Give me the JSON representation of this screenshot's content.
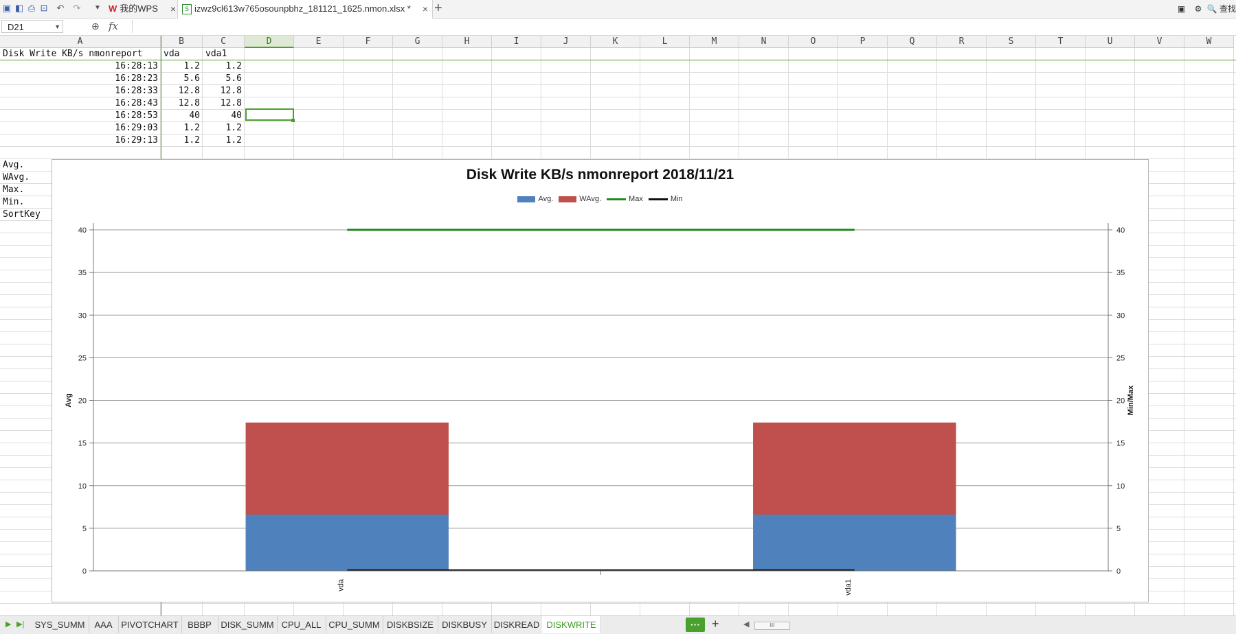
{
  "title_bar": {
    "wps_tab_label": "我的WPS",
    "file_tab_label": "izwz9cl613w765osounpbhz_181121_1625.nmon.xlsx *",
    "close_glyph": "×",
    "new_tab_glyph": "+",
    "search_label": "查找",
    "xls_glyph": "S"
  },
  "formula_bar": {
    "name_box": "D21",
    "fx_label": "fx",
    "formula": ""
  },
  "columns": [
    "A",
    "B",
    "C",
    "D",
    "E",
    "F",
    "G",
    "H",
    "I",
    "J",
    "K",
    "L",
    "M",
    "N",
    "O",
    "P",
    "Q",
    "R",
    "S",
    "T",
    "U",
    "V",
    "W"
  ],
  "selected_column": "D",
  "cells": {
    "header": [
      "Disk Write KB/s nmonreport",
      "vda",
      "vda1"
    ],
    "rows": [
      [
        "16:28:13",
        "1.2",
        "1.2"
      ],
      [
        "16:28:23",
        "5.6",
        "5.6"
      ],
      [
        "16:28:33",
        "12.8",
        "12.8"
      ],
      [
        "16:28:43",
        "12.8",
        "12.8"
      ],
      [
        "16:28:53",
        "40",
        "40"
      ],
      [
        "16:29:03",
        "1.2",
        "1.2"
      ],
      [
        "16:29:13",
        "1.2",
        "1.2"
      ]
    ],
    "stats_labels": [
      "Avg.",
      "WAvg.",
      "Max.",
      "Min.",
      "SortKey"
    ]
  },
  "chart_data": {
    "type": "bar",
    "title": "Disk Write KB/s nmonreport  2018/11/21",
    "categories": [
      "vda",
      "vda1"
    ],
    "series": [
      {
        "name": "Avg.",
        "kind": "stacked-bar",
        "color": "#4f81bd",
        "values": [
          6.6,
          6.6
        ]
      },
      {
        "name": "WAvg.",
        "kind": "stacked-bar",
        "color": "#c0504d",
        "values": [
          10.8,
          10.8
        ]
      },
      {
        "name": "Max",
        "kind": "line",
        "color": "#1e8c1e",
        "values": [
          40,
          40
        ]
      },
      {
        "name": "Min",
        "kind": "line",
        "color": "#111111",
        "values": [
          0.1,
          0.1
        ]
      }
    ],
    "ylabel": "Avg",
    "y2label": "Min/Max",
    "ylim": [
      0,
      40
    ],
    "yticks": [
      0,
      5,
      10,
      15,
      20,
      25,
      30,
      35,
      40
    ],
    "grid": true,
    "legend": "top-center"
  },
  "sheet_tabs": [
    "SYS_SUMM",
    "AAA",
    "PIVOTCHART",
    "BBBP",
    "DISK_SUMM",
    "CPU_ALL",
    "CPU_SUMM",
    "DISKBSIZE",
    "DISKBUSY",
    "DISKREAD",
    "DISKWRITE"
  ],
  "active_sheet": "DISKWRITE",
  "more_tabs_label": "···",
  "add_sheet_glyph": "+",
  "scroll_thumb_label": "III"
}
